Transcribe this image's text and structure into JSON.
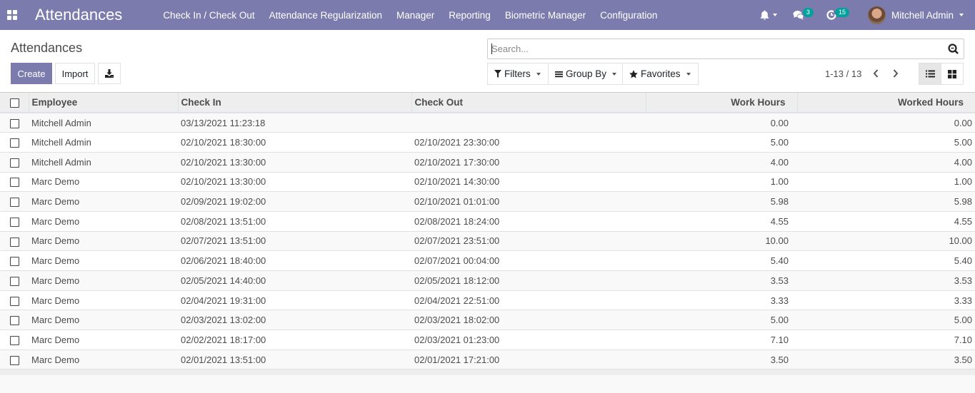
{
  "navbar": {
    "app_title": "Attendances",
    "menu": [
      "Check In / Check Out",
      "Attendance Regularization",
      "Manager",
      "Reporting",
      "Biometric Manager",
      "Configuration"
    ],
    "messages_count": "3",
    "activities_count": "15",
    "user_name": "Mitchell Admin"
  },
  "control_panel": {
    "breadcrumb": "Attendances",
    "create_label": "Create",
    "import_label": "Import",
    "search_placeholder": "Search...",
    "filters_label": "Filters",
    "groupby_label": "Group By",
    "favorites_label": "Favorites",
    "pager": "1-13 / 13"
  },
  "table": {
    "columns": [
      "Employee",
      "Check In",
      "Check Out",
      "Work Hours",
      "Worked Hours"
    ],
    "rows": [
      {
        "employee": "Mitchell Admin",
        "check_in": "03/13/2021 11:23:18",
        "check_out": "",
        "work_hours": "0.00",
        "worked_hours": "0.00"
      },
      {
        "employee": "Mitchell Admin",
        "check_in": "02/10/2021 18:30:00",
        "check_out": "02/10/2021 23:30:00",
        "work_hours": "5.00",
        "worked_hours": "5.00"
      },
      {
        "employee": "Mitchell Admin",
        "check_in": "02/10/2021 13:30:00",
        "check_out": "02/10/2021 17:30:00",
        "work_hours": "4.00",
        "worked_hours": "4.00"
      },
      {
        "employee": "Marc Demo",
        "check_in": "02/10/2021 13:30:00",
        "check_out": "02/10/2021 14:30:00",
        "work_hours": "1.00",
        "worked_hours": "1.00"
      },
      {
        "employee": "Marc Demo",
        "check_in": "02/09/2021 19:02:00",
        "check_out": "02/10/2021 01:01:00",
        "work_hours": "5.98",
        "worked_hours": "5.98"
      },
      {
        "employee": "Marc Demo",
        "check_in": "02/08/2021 13:51:00",
        "check_out": "02/08/2021 18:24:00",
        "work_hours": "4.55",
        "worked_hours": "4.55"
      },
      {
        "employee": "Marc Demo",
        "check_in": "02/07/2021 13:51:00",
        "check_out": "02/07/2021 23:51:00",
        "work_hours": "10.00",
        "worked_hours": "10.00"
      },
      {
        "employee": "Marc Demo",
        "check_in": "02/06/2021 18:40:00",
        "check_out": "02/07/2021 00:04:00",
        "work_hours": "5.40",
        "worked_hours": "5.40"
      },
      {
        "employee": "Marc Demo",
        "check_in": "02/05/2021 14:40:00",
        "check_out": "02/05/2021 18:12:00",
        "work_hours": "3.53",
        "worked_hours": "3.53"
      },
      {
        "employee": "Marc Demo",
        "check_in": "02/04/2021 19:31:00",
        "check_out": "02/04/2021 22:51:00",
        "work_hours": "3.33",
        "worked_hours": "3.33"
      },
      {
        "employee": "Marc Demo",
        "check_in": "02/03/2021 13:02:00",
        "check_out": "02/03/2021 18:02:00",
        "work_hours": "5.00",
        "worked_hours": "5.00"
      },
      {
        "employee": "Marc Demo",
        "check_in": "02/02/2021 18:17:00",
        "check_out": "02/03/2021 01:23:00",
        "work_hours": "7.10",
        "worked_hours": "7.10"
      },
      {
        "employee": "Marc Demo",
        "check_in": "02/01/2021 13:51:00",
        "check_out": "02/01/2021 17:21:00",
        "work_hours": "3.50",
        "worked_hours": "3.50"
      }
    ]
  },
  "colors": {
    "brand": "#7c7bad",
    "badge": "#00a09d"
  }
}
